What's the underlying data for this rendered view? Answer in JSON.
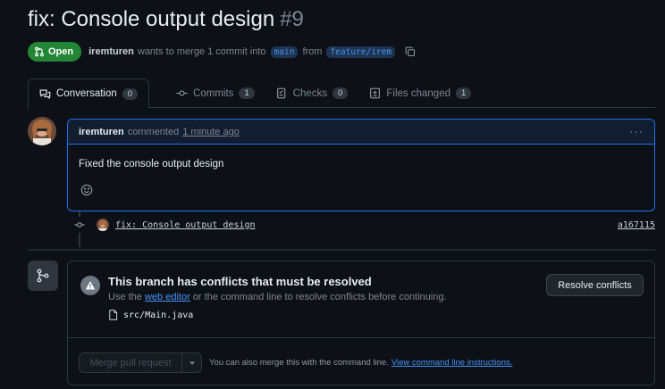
{
  "pr": {
    "title": "fix: Console output design",
    "number": "#9",
    "state": "Open",
    "author": "iremturen",
    "merge_text": "wants to merge 1 commit into",
    "base_branch": "main",
    "from_text": "from",
    "head_branch": "feature/irem"
  },
  "tabs": [
    {
      "label": "Conversation",
      "count": "0",
      "icon": "comment-discussion-icon"
    },
    {
      "label": "Commits",
      "count": "1",
      "icon": "git-commit-icon"
    },
    {
      "label": "Checks",
      "count": "0",
      "icon": "checklist-icon"
    },
    {
      "label": "Files changed",
      "count": "1",
      "icon": "file-diff-icon"
    }
  ],
  "comment": {
    "author": "iremturen",
    "action": "commented",
    "time": "1 minute ago",
    "body": "Fixed the console output design",
    "menu": "···"
  },
  "commit": {
    "message": "fix: Console output design",
    "sha": "a167115"
  },
  "conflicts": {
    "title": "This branch has conflicts that must be resolved",
    "sub_prefix": "Use the",
    "sub_link": "web editor",
    "sub_suffix": "or the command line to resolve conflicts before continuing.",
    "file": "src/Main.java",
    "resolve_label": "Resolve conflicts"
  },
  "merge": {
    "button_label": "Merge pull request",
    "note": "You can also merge this with the command line.",
    "note_link": "View command line instructions."
  },
  "colors": {
    "background": "#0d1117",
    "open_green": "#238636",
    "accent_blue": "#1f6feb",
    "link_blue": "#4493f8",
    "border": "#30363d"
  }
}
